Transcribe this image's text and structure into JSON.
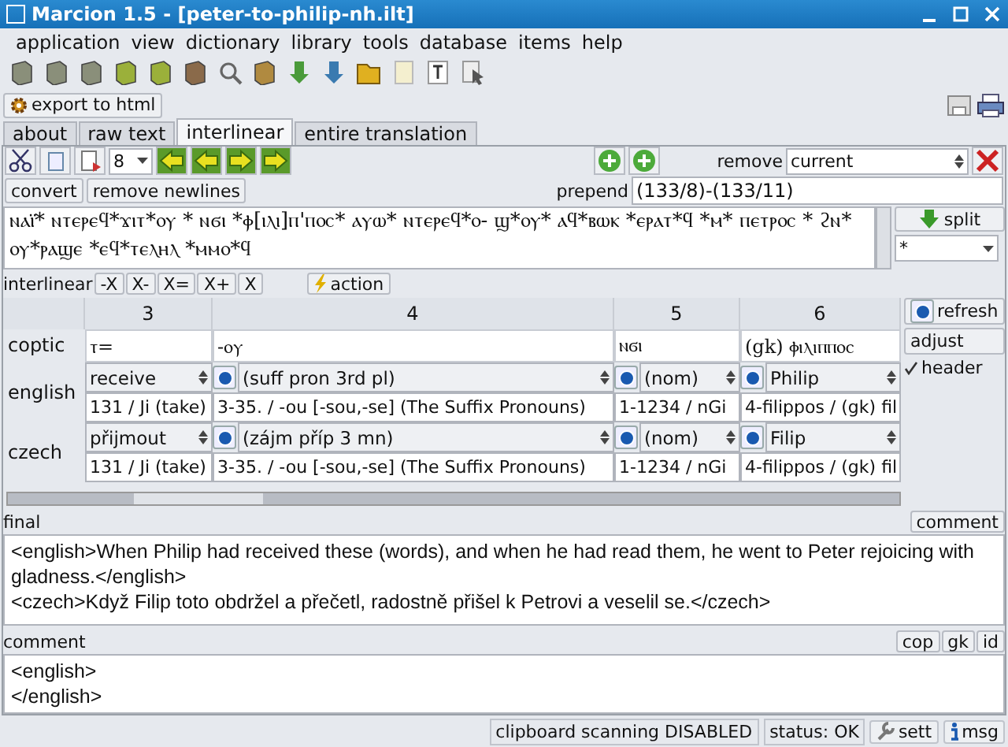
{
  "window": {
    "title": "Marcion 1.5 - [peter-to-philip-nh.ilt]"
  },
  "menu": [
    "application",
    "view",
    "dictionary",
    "library",
    "tools",
    "database",
    "items",
    "help"
  ],
  "export_button": "export to html",
  "tabs": [
    {
      "label": "about",
      "selected": false
    },
    {
      "label": "raw text",
      "selected": false
    },
    {
      "label": "interlinear",
      "selected": true
    },
    {
      "label": "entire translation",
      "selected": false
    }
  ],
  "nav": {
    "page": "8",
    "remove_label": "remove",
    "remove_value": "current"
  },
  "source": {
    "buttons": [
      "convert",
      "remove newlines"
    ],
    "prepend_label": "prepend",
    "prepend_value": "(133/8)-(133/11)",
    "text": "ⲛⲁⲓ̈* ⲛⲧⲉⲣⲉϥ*ϫⲓⲧ*ⲟⲩ * ⲛϭⲓ *ⲫ[ⲓⲗⲓ]ⲡ'ⲡⲟⲥ* ⲁⲩⲱ* ⲛⲧⲉⲣⲉϥ*ⲟ- ϣ*ⲟⲩ* ⲁϥ*ⲃⲱⲕ *ⲉⲣⲁⲧ*ϥ *ⲙ* ⲡⲉⲧⲣⲟⲥ * ϩⲛ* ⲟⲩ*ⲣⲁϣⲉ *ⲉϥ*ⲧⲉⲗⲏⲗ *ⲙⲙⲟ*ϥ",
    "split_button": "split",
    "split_value": "*"
  },
  "interlinear": {
    "label": "interlinear",
    "buttons": [
      "-X",
      "X-",
      "X=",
      "X+",
      "X"
    ],
    "action": "action"
  },
  "grid": {
    "columns": [
      "3",
      "4",
      "5",
      "6"
    ],
    "coptic": {
      "label": "coptic",
      "cells": [
        "ⲧ=",
        "-ⲟⲩ",
        "ⲛϭⲓ",
        "(gk) ⲫⲓⲗⲓⲡⲡⲟⲥ"
      ]
    },
    "languages": [
      {
        "label": "english",
        "words": [
          {
            "value": "receive",
            "radio": false
          },
          {
            "value": "(suff pron 3rd pl)",
            "radio": true
          },
          {
            "value": "(nom)",
            "radio": true
          },
          {
            "value": "Philip",
            "radio": true
          }
        ],
        "refs": [
          "131 / Ji (take)",
          "3-35. / -ou [-sou,-se] (The Suffix Pronouns)",
          "1-1234 / nGi",
          "4-filippos / (gk) fil"
        ]
      },
      {
        "label": "czech",
        "words": [
          {
            "value": "přijmout",
            "radio": false
          },
          {
            "value": "(zájm příp 3 mn)",
            "radio": true
          },
          {
            "value": "(nom)",
            "radio": true
          },
          {
            "value": "Filip",
            "radio": true
          }
        ],
        "refs": [
          "131 / Ji (take)",
          "3-35. / -ou [-sou,-se] (The Suffix Pronouns)",
          "1-1234 / nGi",
          "4-filippos / (gk) fil"
        ]
      }
    ]
  },
  "side": {
    "refresh": "refresh",
    "adjust": "adjust",
    "header": {
      "label": "header",
      "checked": true
    }
  },
  "final": {
    "label": "final",
    "button": "comment",
    "lines": [
      "<english>When Philip had received these (words), and when he had read them, he went to Peter rejoicing with gladness.</english>",
      "<czech>Když Filip toto obdržel a přečetl, radostně přišel k Petrovi a veselil se.</czech>"
    ]
  },
  "comment": {
    "label": "comment",
    "buttons": [
      "cop",
      "gk",
      "id"
    ],
    "lines": [
      "<english>",
      "</english>"
    ]
  },
  "status_bar": {
    "clipboard": "clipboard scanning DISABLED",
    "status": "status: OK",
    "sett": "sett",
    "msg": "msg"
  }
}
